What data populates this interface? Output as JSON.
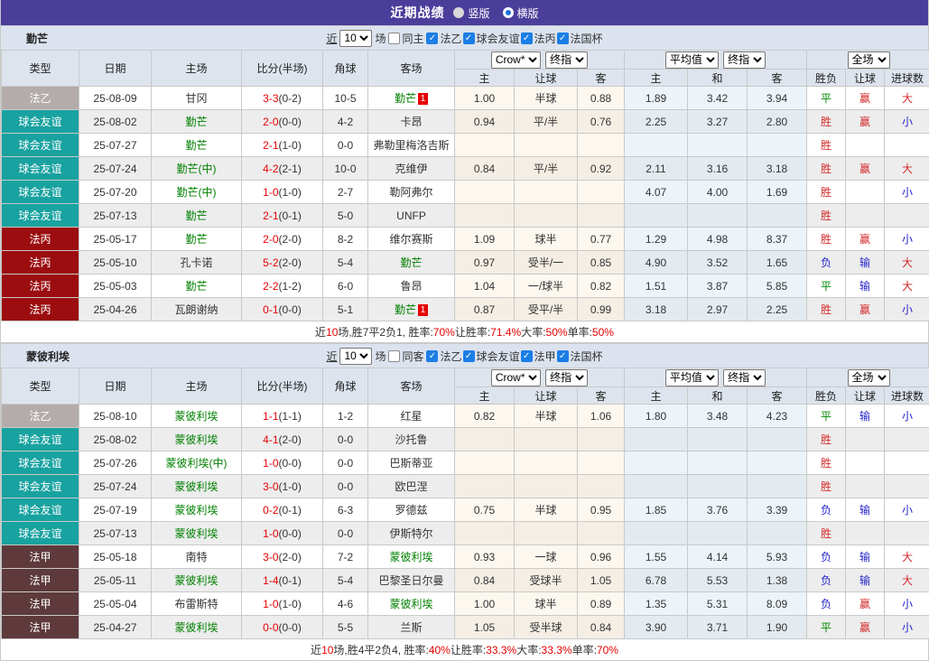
{
  "title_bar": {
    "title": "近期战绩",
    "radios": [
      {
        "label": "竖版",
        "selected": false
      },
      {
        "label": "横版",
        "selected": true
      }
    ]
  },
  "colors": {
    "title_purple": "#4b3e9b",
    "league_fa_yi_gray": "#b3acab",
    "friendly_teal": "#18a2a0",
    "league_fa_bing_red": "#9c0d10",
    "league_fa_jia_maroon": "#5e3a3c",
    "team_green": "#008000",
    "score_red": "#e60000",
    "win_red": "#d42a2a",
    "lose_blue": "#2424cc",
    "draw_green": "#008800"
  },
  "sections": [
    {
      "team": "勤芒",
      "filter": {
        "prefix": "近",
        "matches_value": "10",
        "suffix": "场",
        "same_checkbox": {
          "label": "同主",
          "checked": false
        },
        "league_checkboxes": [
          {
            "label": "法乙",
            "checked": true
          },
          {
            "label": "球会友谊",
            "checked": true
          },
          {
            "label": "法丙",
            "checked": true
          },
          {
            "label": "法国杯",
            "checked": true
          }
        ]
      },
      "header": {
        "static_columns": [
          "类型",
          "日期",
          "主场",
          "比分(半场)",
          "角球",
          "客场"
        ],
        "selects": {
          "odds_source": "Crow*",
          "odds_stage1": "终指",
          "avg": "平均值",
          "odds_stage2": "终指",
          "scope": "全场"
        },
        "sub_columns": [
          "主",
          "让球",
          "客",
          "主",
          "和",
          "客",
          "胜负",
          "让球",
          "进球数"
        ]
      },
      "rows": [
        {
          "league": "法乙",
          "league_class": "l2",
          "date": "25-08-09",
          "home": "甘冈",
          "home_is_team": false,
          "home_badge": "",
          "score": "3-3",
          "half": "(0-2)",
          "corners": "10-5",
          "away": "勤芒",
          "away_is_team": true,
          "away_badge": "1",
          "odds": [
            "1.00",
            "半球",
            "0.88"
          ],
          "avg": [
            "1.89",
            "3.42",
            "3.94"
          ],
          "outcomes": [
            "平",
            "赢",
            "大"
          ],
          "outcome_classes": [
            "g",
            "r",
            "r"
          ]
        },
        {
          "league": "球会友谊",
          "league_class": "fr",
          "date": "25-08-02",
          "home": "勤芒",
          "home_is_team": true,
          "home_badge": "",
          "score": "2-0",
          "half": "(0-0)",
          "corners": "4-2",
          "away": "卡昂",
          "away_is_team": false,
          "away_badge": "",
          "odds": [
            "0.94",
            "平/半",
            "0.76"
          ],
          "avg": [
            "2.25",
            "3.27",
            "2.80"
          ],
          "outcomes": [
            "胜",
            "赢",
            "小"
          ],
          "outcome_classes": [
            "r",
            "r",
            "b"
          ]
        },
        {
          "league": "球会友谊",
          "league_class": "fr",
          "date": "25-07-27",
          "home": "勤芒",
          "home_is_team": true,
          "home_badge": "",
          "score": "2-1",
          "half": "(1-0)",
          "corners": "0-0",
          "away": "弗勒里梅洛吉斯",
          "away_is_team": false,
          "away_badge": "",
          "odds": [
            "",
            "",
            ""
          ],
          "avg": [
            "",
            "",
            ""
          ],
          "outcomes": [
            "胜",
            "",
            ""
          ],
          "outcome_classes": [
            "r",
            "",
            ""
          ]
        },
        {
          "league": "球会友谊",
          "league_class": "fr",
          "date": "25-07-24",
          "home": "勤芒(中)",
          "home_is_team": true,
          "home_badge": "",
          "score": "4-2",
          "half": "(2-1)",
          "corners": "10-0",
          "away": "克维伊",
          "away_is_team": false,
          "away_badge": "",
          "odds": [
            "0.84",
            "平/半",
            "0.92"
          ],
          "avg": [
            "2.11",
            "3.16",
            "3.18"
          ],
          "outcomes": [
            "胜",
            "赢",
            "大"
          ],
          "outcome_classes": [
            "r",
            "r",
            "r"
          ]
        },
        {
          "league": "球会友谊",
          "league_class": "fr",
          "date": "25-07-20",
          "home": "勤芒(中)",
          "home_is_team": true,
          "home_badge": "",
          "score": "1-0",
          "half": "(1-0)",
          "corners": "2-7",
          "away": "勒阿弗尔",
          "away_is_team": false,
          "away_badge": "",
          "odds": [
            "",
            "",
            ""
          ],
          "avg": [
            "4.07",
            "4.00",
            "1.69"
          ],
          "outcomes": [
            "胜",
            "",
            "小"
          ],
          "outcome_classes": [
            "r",
            "",
            "b"
          ]
        },
        {
          "league": "球会友谊",
          "league_class": "fr",
          "date": "25-07-13",
          "home": "勤芒",
          "home_is_team": true,
          "home_badge": "",
          "score": "2-1",
          "half": "(0-1)",
          "corners": "5-0",
          "away": "UNFP",
          "away_is_team": false,
          "away_badge": "",
          "odds": [
            "",
            "",
            ""
          ],
          "avg": [
            "",
            "",
            ""
          ],
          "outcomes": [
            "胜",
            "",
            ""
          ],
          "outcome_classes": [
            "r",
            "",
            ""
          ]
        },
        {
          "league": "法丙",
          "league_class": "l3",
          "date": "25-05-17",
          "home": "勤芒",
          "home_is_team": true,
          "home_badge": "",
          "score": "2-0",
          "half": "(2-0)",
          "corners": "8-2",
          "away": "维尔赛斯",
          "away_is_team": false,
          "away_badge": "",
          "odds": [
            "1.09",
            "球半",
            "0.77"
          ],
          "avg": [
            "1.29",
            "4.98",
            "8.37"
          ],
          "outcomes": [
            "胜",
            "赢",
            "小"
          ],
          "outcome_classes": [
            "r",
            "r",
            "b"
          ]
        },
        {
          "league": "法丙",
          "league_class": "l3",
          "date": "25-05-10",
          "home": "孔卡诺",
          "home_is_team": false,
          "home_badge": "",
          "score": "5-2",
          "half": "(2-0)",
          "corners": "5-4",
          "away": "勤芒",
          "away_is_team": true,
          "away_badge": "",
          "odds": [
            "0.97",
            "受半/一",
            "0.85"
          ],
          "avg": [
            "4.90",
            "3.52",
            "1.65"
          ],
          "outcomes": [
            "负",
            "输",
            "大"
          ],
          "outcome_classes": [
            "b",
            "b",
            "r"
          ]
        },
        {
          "league": "法丙",
          "league_class": "l3",
          "date": "25-05-03",
          "home": "勤芒",
          "home_is_team": true,
          "home_badge": "",
          "score": "2-2",
          "half": "(1-2)",
          "corners": "6-0",
          "away": "鲁昂",
          "away_is_team": false,
          "away_badge": "",
          "odds": [
            "1.04",
            "一/球半",
            "0.82"
          ],
          "avg": [
            "1.51",
            "3.87",
            "5.85"
          ],
          "outcomes": [
            "平",
            "输",
            "大"
          ],
          "outcome_classes": [
            "g",
            "b",
            "r"
          ]
        },
        {
          "league": "法丙",
          "league_class": "l3",
          "date": "25-04-26",
          "home": "瓦朗谢纳",
          "home_is_team": false,
          "home_badge": "",
          "score": "0-1",
          "half": "(0-0)",
          "corners": "5-1",
          "away": "勤芒",
          "away_is_team": true,
          "away_badge": "1",
          "odds": [
            "0.87",
            "受平/半",
            "0.99"
          ],
          "avg": [
            "3.18",
            "2.97",
            "2.25"
          ],
          "outcomes": [
            "胜",
            "赢",
            "小"
          ],
          "outcome_classes": [
            "r",
            "r",
            "b"
          ]
        }
      ],
      "summary": [
        {
          "text": "近",
          "red": false
        },
        {
          "text": "10",
          "red": true
        },
        {
          "text": "场,胜7平2负1, 胜率:",
          "red": false
        },
        {
          "text": "70%",
          "red": true
        },
        {
          "text": " 让胜率:",
          "red": false
        },
        {
          "text": "71.4%",
          "red": true
        },
        {
          "text": " 大率:",
          "red": false
        },
        {
          "text": "50%",
          "red": true
        },
        {
          "text": " 单率:",
          "red": false
        },
        {
          "text": "50%",
          "red": true
        }
      ]
    },
    {
      "team": "蒙彼利埃",
      "filter": {
        "prefix": "近",
        "matches_value": "10",
        "suffix": "场",
        "same_checkbox": {
          "label": "同客",
          "checked": false
        },
        "league_checkboxes": [
          {
            "label": "法乙",
            "checked": true
          },
          {
            "label": "球会友谊",
            "checked": true
          },
          {
            "label": "法甲",
            "checked": true
          },
          {
            "label": "法国杯",
            "checked": true
          }
        ]
      },
      "header": {
        "static_columns": [
          "类型",
          "日期",
          "主场",
          "比分(半场)",
          "角球",
          "客场"
        ],
        "selects": {
          "odds_source": "Crow*",
          "odds_stage1": "终指",
          "avg": "平均值",
          "odds_stage2": "终指",
          "scope": "全场"
        },
        "sub_columns": [
          "主",
          "让球",
          "客",
          "主",
          "和",
          "客",
          "胜负",
          "让球",
          "进球数"
        ]
      },
      "rows": [
        {
          "league": "法乙",
          "league_class": "l2",
          "date": "25-08-10",
          "home": "蒙彼利埃",
          "home_is_team": true,
          "home_badge": "",
          "score": "1-1",
          "half": "(1-1)",
          "corners": "1-2",
          "away": "红星",
          "away_is_team": false,
          "away_badge": "",
          "odds": [
            "0.82",
            "半球",
            "1.06"
          ],
          "avg": [
            "1.80",
            "3.48",
            "4.23"
          ],
          "outcomes": [
            "平",
            "输",
            "小"
          ],
          "outcome_classes": [
            "g",
            "b",
            "b"
          ]
        },
        {
          "league": "球会友谊",
          "league_class": "fr",
          "date": "25-08-02",
          "home": "蒙彼利埃",
          "home_is_team": true,
          "home_badge": "",
          "score": "4-1",
          "half": "(2-0)",
          "corners": "0-0",
          "away": "沙托鲁",
          "away_is_team": false,
          "away_badge": "",
          "odds": [
            "",
            "",
            ""
          ],
          "avg": [
            "",
            "",
            ""
          ],
          "outcomes": [
            "胜",
            "",
            ""
          ],
          "outcome_classes": [
            "r",
            "",
            ""
          ]
        },
        {
          "league": "球会友谊",
          "league_class": "fr",
          "date": "25-07-26",
          "home": "蒙彼利埃(中)",
          "home_is_team": true,
          "home_badge": "",
          "score": "1-0",
          "half": "(0-0)",
          "corners": "0-0",
          "away": "巴斯蒂亚",
          "away_is_team": false,
          "away_badge": "",
          "odds": [
            "",
            "",
            ""
          ],
          "avg": [
            "",
            "",
            ""
          ],
          "outcomes": [
            "胜",
            "",
            ""
          ],
          "outcome_classes": [
            "r",
            "",
            ""
          ]
        },
        {
          "league": "球会友谊",
          "league_class": "fr",
          "date": "25-07-24",
          "home": "蒙彼利埃",
          "home_is_team": true,
          "home_badge": "",
          "score": "3-0",
          "half": "(1-0)",
          "corners": "0-0",
          "away": "欧巴涅",
          "away_is_team": false,
          "away_badge": "",
          "odds": [
            "",
            "",
            ""
          ],
          "avg": [
            "",
            "",
            ""
          ],
          "outcomes": [
            "胜",
            "",
            ""
          ],
          "outcome_classes": [
            "r",
            "",
            ""
          ]
        },
        {
          "league": "球会友谊",
          "league_class": "fr",
          "date": "25-07-19",
          "home": "蒙彼利埃",
          "home_is_team": true,
          "home_badge": "",
          "score": "0-2",
          "half": "(0-1)",
          "corners": "6-3",
          "away": "罗德兹",
          "away_is_team": false,
          "away_badge": "",
          "odds": [
            "0.75",
            "半球",
            "0.95"
          ],
          "avg": [
            "1.85",
            "3.76",
            "3.39"
          ],
          "outcomes": [
            "负",
            "输",
            "小"
          ],
          "outcome_classes": [
            "b",
            "b",
            "b"
          ]
        },
        {
          "league": "球会友谊",
          "league_class": "fr",
          "date": "25-07-13",
          "home": "蒙彼利埃",
          "home_is_team": true,
          "home_badge": "",
          "score": "1-0",
          "half": "(0-0)",
          "corners": "0-0",
          "away": "伊斯特尔",
          "away_is_team": false,
          "away_badge": "",
          "odds": [
            "",
            "",
            ""
          ],
          "avg": [
            "",
            "",
            ""
          ],
          "outcomes": [
            "胜",
            "",
            ""
          ],
          "outcome_classes": [
            "r",
            "",
            ""
          ]
        },
        {
          "league": "法甲",
          "league_class": "l1",
          "date": "25-05-18",
          "home": "南特",
          "home_is_team": false,
          "home_badge": "",
          "score": "3-0",
          "half": "(2-0)",
          "corners": "7-2",
          "away": "蒙彼利埃",
          "away_is_team": true,
          "away_badge": "",
          "odds": [
            "0.93",
            "一球",
            "0.96"
          ],
          "avg": [
            "1.55",
            "4.14",
            "5.93"
          ],
          "outcomes": [
            "负",
            "输",
            "大"
          ],
          "outcome_classes": [
            "b",
            "b",
            "r"
          ]
        },
        {
          "league": "法甲",
          "league_class": "l1",
          "date": "25-05-11",
          "home": "蒙彼利埃",
          "home_is_team": true,
          "home_badge": "",
          "score": "1-4",
          "half": "(0-1)",
          "corners": "5-4",
          "away": "巴黎圣日尔曼",
          "away_is_team": false,
          "away_badge": "",
          "odds": [
            "0.84",
            "受球半",
            "1.05"
          ],
          "avg": [
            "6.78",
            "5.53",
            "1.38"
          ],
          "outcomes": [
            "负",
            "输",
            "大"
          ],
          "outcome_classes": [
            "b",
            "b",
            "r"
          ]
        },
        {
          "league": "法甲",
          "league_class": "l1",
          "date": "25-05-04",
          "home": "布雷斯特",
          "home_is_team": false,
          "home_badge": "",
          "score": "1-0",
          "half": "(1-0)",
          "corners": "4-6",
          "away": "蒙彼利埃",
          "away_is_team": true,
          "away_badge": "",
          "odds": [
            "1.00",
            "球半",
            "0.89"
          ],
          "avg": [
            "1.35",
            "5.31",
            "8.09"
          ],
          "outcomes": [
            "负",
            "赢",
            "小"
          ],
          "outcome_classes": [
            "b",
            "r",
            "b"
          ]
        },
        {
          "league": "法甲",
          "league_class": "l1",
          "date": "25-04-27",
          "home": "蒙彼利埃",
          "home_is_team": true,
          "home_badge": "",
          "score": "0-0",
          "half": "(0-0)",
          "corners": "5-5",
          "away": "兰斯",
          "away_is_team": false,
          "away_badge": "",
          "odds": [
            "1.05",
            "受半球",
            "0.84"
          ],
          "avg": [
            "3.90",
            "3.71",
            "1.90"
          ],
          "outcomes": [
            "平",
            "赢",
            "小"
          ],
          "outcome_classes": [
            "g",
            "r",
            "b"
          ]
        }
      ],
      "summary": [
        {
          "text": "近",
          "red": false
        },
        {
          "text": "10",
          "red": true
        },
        {
          "text": "场,胜4平2负4, 胜率:",
          "red": false
        },
        {
          "text": "40%",
          "red": true
        },
        {
          "text": " 让胜率:",
          "red": false
        },
        {
          "text": "33.3%",
          "red": true
        },
        {
          "text": " 大率:",
          "red": false
        },
        {
          "text": "33.3%",
          "red": true
        },
        {
          "text": " 单率:",
          "red": false
        },
        {
          "text": "70%",
          "red": true
        }
      ]
    }
  ]
}
